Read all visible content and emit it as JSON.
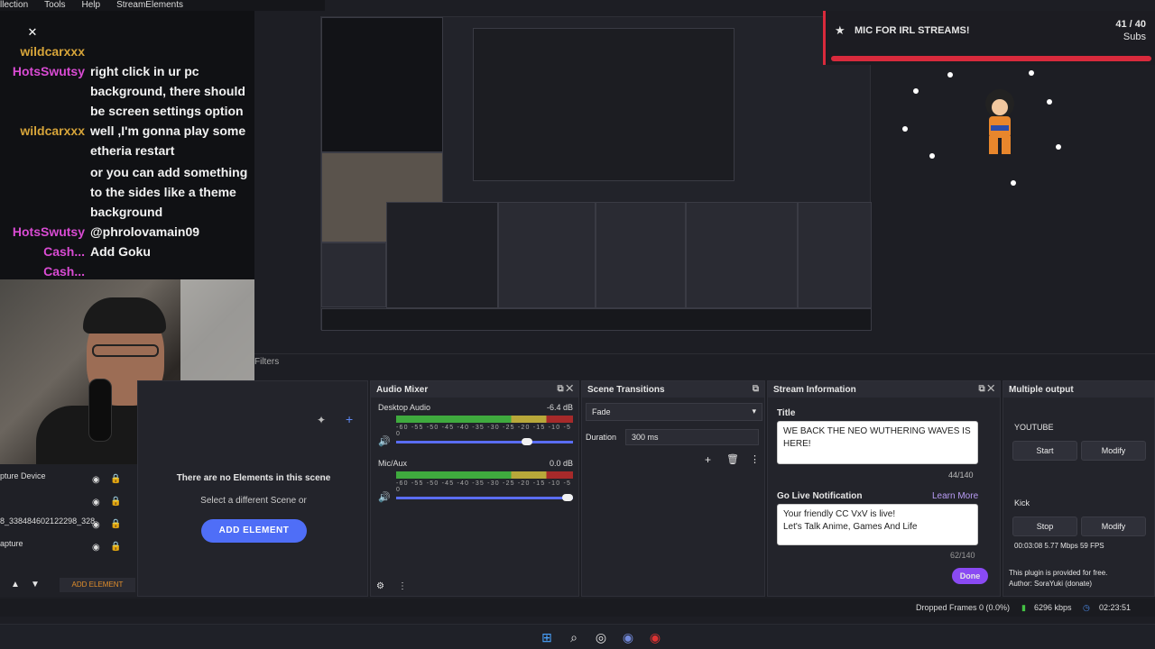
{
  "menubar": {
    "items": [
      "llection",
      "Tools",
      "Help",
      "StreamElements"
    ]
  },
  "chat": {
    "lines": [
      {
        "name": "wildcarxxx",
        "text": ""
      },
      {
        "name": "HotsSwutsy",
        "text": "right click in ur pc background, there should be screen settings option"
      },
      {
        "name": "wildcarxxx",
        "text": "well ,I'm gonna play some etheria restart"
      },
      {
        "name": "",
        "text": "or you can add something to the sides like a theme background"
      },
      {
        "name": "HotsSwutsy",
        "text": "@phrolovamain09"
      },
      {
        "name": "Cash...",
        "text": "Add Goku"
      },
      {
        "name": "Cash...",
        "text": ""
      }
    ]
  },
  "alert": {
    "title": "MIC FOR IRL STREAMS!",
    "count": "41 / 40",
    "unit": "Subs"
  },
  "filters_label": "Filters",
  "sources": {
    "rows": [
      "pture Device",
      "",
      "8_338484602122298_328",
      "apture"
    ],
    "add_label": "ADD ELEMENT"
  },
  "scene": {
    "empty_title": "There are no Elements in this scene",
    "empty_sub": "Select a different Scene or",
    "add_label": "ADD ELEMENT"
  },
  "mixer": {
    "title": "Audio Mixer",
    "desktop_label": "Desktop Audio",
    "desktop_db": "-6.4 dB",
    "mic_label": "Mic/Aux",
    "mic_db": "0.0 dB",
    "ticks": "-60 -55 -50 -45 -40 -35 -30 -25 -20 -15 -10 -5 0",
    "desktop_level": 0.74,
    "mic_level": 0.97
  },
  "transitions": {
    "title": "Scene Transitions",
    "selected": "Fade",
    "duration_label": "Duration",
    "duration_value": "300 ms"
  },
  "streaminfo": {
    "title": "Stream Information",
    "title_label": "Title",
    "title_value": "WE BACK  THE NEO WUTHERING WAVES IS HERE!",
    "title_count": "44/140",
    "golive_label": "Go Live Notification",
    "learn_more": "Learn More",
    "golive_value_1": "Your friendly CC VxV is live!",
    "golive_value_2": "Let's Talk Anime, Games And Life",
    "golive_count": "62/140",
    "done_label": "Done"
  },
  "multi": {
    "title": "Multiple output",
    "youtube_label": "YOUTUBE",
    "start_label": "Start",
    "modify_label": "Modify",
    "kick_label": "Kick",
    "stop_label": "Stop",
    "modify2_label": "Modify",
    "stats": "00:03:08  5.77 Mbps  59 FPS",
    "plugin_note": "This plugin is provided for free.",
    "author": "Author: SoraYuki (donate)"
  },
  "status": {
    "dropped": "Dropped Frames 0 (0.0%)",
    "kbps": "6296 kbps",
    "time": "02:23:51"
  }
}
